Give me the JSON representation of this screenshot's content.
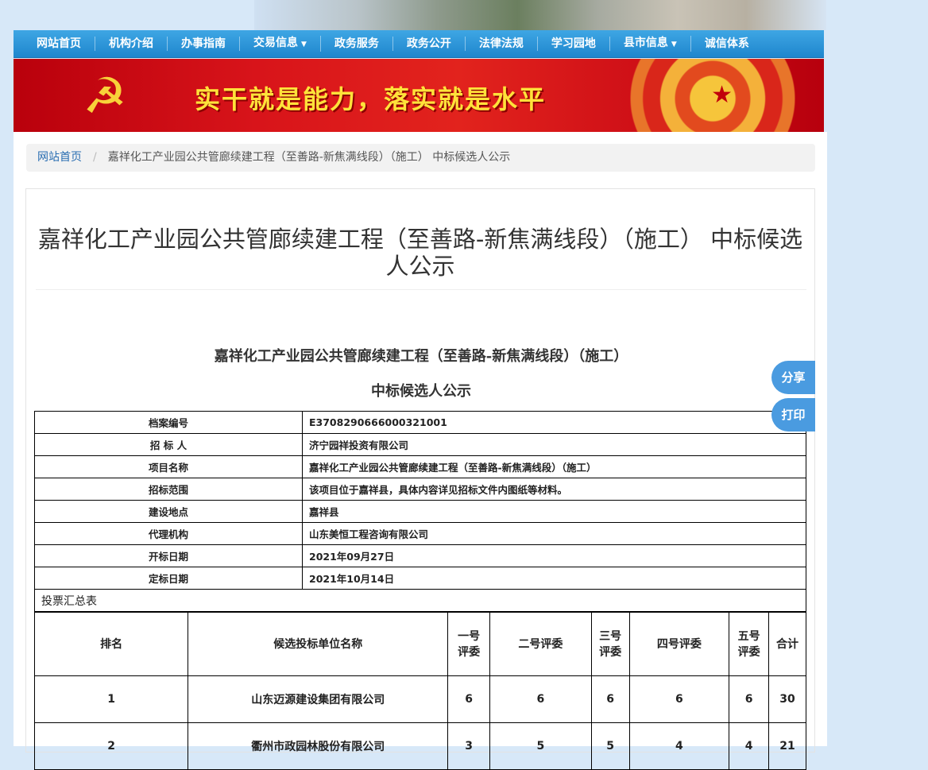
{
  "nav": {
    "items": [
      {
        "label": "网站首页",
        "dropdown": false
      },
      {
        "label": "机构介绍",
        "dropdown": false
      },
      {
        "label": "办事指南",
        "dropdown": false
      },
      {
        "label": "交易信息",
        "dropdown": true
      },
      {
        "label": "政务服务",
        "dropdown": false
      },
      {
        "label": "政务公开",
        "dropdown": false
      },
      {
        "label": "法律法规",
        "dropdown": false
      },
      {
        "label": "学习园地",
        "dropdown": false
      },
      {
        "label": "县市信息",
        "dropdown": true
      },
      {
        "label": "诚信体系",
        "dropdown": false
      }
    ],
    "caret_icon": "caret-down-icon"
  },
  "banner": {
    "slogan": "实干就是能力，落实就是水平",
    "emblem_icon": "party-emblem-icon",
    "star_icon": "star-icon"
  },
  "breadcrumb": {
    "home": "网站首页",
    "separator": "/",
    "current": "嘉祥化工产业园公共管廊续建工程（至善路-新焦满线段）（施工） 中标候选人公示"
  },
  "article": {
    "title": "嘉祥化工产业园公共管廊续建工程（至善路-新焦满线段）（施工） 中标候选人公示",
    "subtitle_line1": "嘉祥化工产业园公共管廊续建工程（至善路-新焦满线段）（施工）",
    "subtitle_line2": "中标候选人公示"
  },
  "info_table": {
    "rows": [
      {
        "label": "档案编号",
        "value": "E3708290666000321001"
      },
      {
        "label": "招 标 人",
        "value": "济宁园祥投资有限公司"
      },
      {
        "label": "项目名称",
        "value": "嘉祥化工产业园公共管廊续建工程（至善路-新焦满线段）（施工）"
      },
      {
        "label": "招标范围",
        "value": "该项目位于嘉祥县，具体内容详见招标文件内图纸等材料。"
      },
      {
        "label": "建设地点",
        "value": "嘉祥县"
      },
      {
        "label": "代理机构",
        "value": "山东美恒工程咨询有限公司"
      },
      {
        "label": "开标日期",
        "value": "2021年09月27日"
      },
      {
        "label": "定标日期",
        "value": "2021年10月14日"
      }
    ],
    "section_label": "投票汇总表"
  },
  "vote_table": {
    "headers": {
      "rank": "排名",
      "company": "候选投标单位名称",
      "j1a": "一号",
      "j1b": "评委",
      "j2": "二号评委",
      "j3a": "三号",
      "j3b": "评委",
      "j4": "四号评委",
      "j5a": "五号",
      "j5b": "评委",
      "total": "合计"
    },
    "rows": [
      {
        "rank": "1",
        "company": "山东迈源建设集团有限公司",
        "j1": "6",
        "j2": "6",
        "j3": "6",
        "j4": "6",
        "j5": "6",
        "total": "30"
      },
      {
        "rank": "2",
        "company": "衢州市政园林股份有限公司",
        "j1": "3",
        "j2": "5",
        "j3": "5",
        "j4": "4",
        "j5": "4",
        "total": "21"
      }
    ]
  },
  "side": {
    "share": "分享",
    "print": "打印"
  }
}
